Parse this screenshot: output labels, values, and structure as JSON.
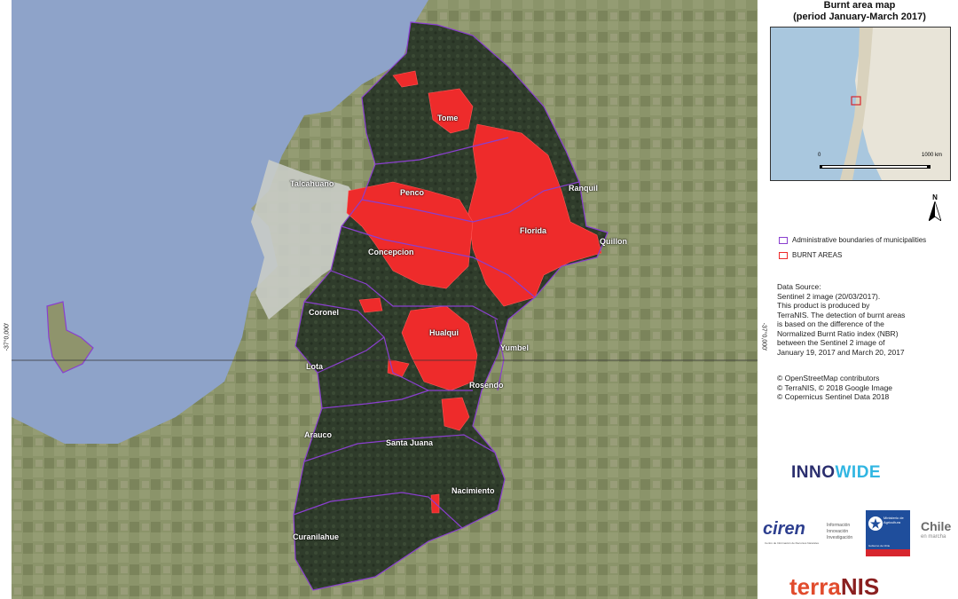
{
  "map": {
    "municipalities": [
      {
        "id": "tome",
        "name": "Tome"
      },
      {
        "id": "talcahuano",
        "name": "Talcahuano"
      },
      {
        "id": "penco",
        "name": "Penco"
      },
      {
        "id": "ranquil",
        "name": "Ranquil"
      },
      {
        "id": "florida",
        "name": "Florida"
      },
      {
        "id": "quillon",
        "name": "Quillon"
      },
      {
        "id": "concepcion",
        "name": "Concepcion"
      },
      {
        "id": "coronel",
        "name": "Coronel"
      },
      {
        "id": "hualqui",
        "name": "Hualqui"
      },
      {
        "id": "yumbel",
        "name": "Yumbel"
      },
      {
        "id": "lota",
        "name": "Lota"
      },
      {
        "id": "rosendo",
        "name": "Rosendo"
      },
      {
        "id": "arauco",
        "name": "Arauco"
      },
      {
        "id": "santa_juana",
        "name": "Santa Juana"
      },
      {
        "id": "nacimiento",
        "name": "Nacimiento"
      },
      {
        "id": "curanilahue",
        "name": "Curanilahue"
      }
    ],
    "coord_left": "-37°0,000'",
    "coord_right": "-37°0,000'"
  },
  "side": {
    "title_line1": "Burnt area map",
    "title_line2": "(period January-March 2017)",
    "inset": {
      "scale_start": "0",
      "scale_end": "1000 km"
    },
    "north_label": "N",
    "legend": [
      {
        "label": "Administrative boundaries of municipalities",
        "color": "#8a3fcf",
        "kind": "boundary"
      },
      {
        "label": "BURNT AREAS",
        "color": "#ee2b2b",
        "kind": "burnt"
      }
    ],
    "data_source": [
      "Data Source:",
      "Sentinel 2 image (20/03/2017).",
      "This product is produced by",
      "TerraNIS. The detection of burnt areas",
      "is based on the difference of the",
      "Normalized Burnt Ratio index (NBR)",
      "between the Sentinel 2 image of",
      "January 19, 2017 and March 20, 2017"
    ],
    "credits": [
      "© OpenStreetMap contributors",
      "© TerraNIS, © 2018 Google Image",
      "© Copernicus Sentinel Data 2018"
    ],
    "logos": {
      "innowide_a": "INNO",
      "innowide_b": "WIDE",
      "ciren": "ciren",
      "ciren_sub": "Centro de Información de Recursos Naturales",
      "ciren_lines": [
        "Información",
        "Innovación",
        "Investigación"
      ],
      "ministry": "Ministerio de Agricultura",
      "ministry_foot": "Gobierno de Chile",
      "chile": "Chile",
      "chile_sub": "en marcha",
      "terranis_a": "terra",
      "terranis_b": "NIS"
    }
  },
  "colors": {
    "sea": "#8aa0c7",
    "land": "#8a9368",
    "forest": "#2c3a29",
    "burnt": "#ee2b2b",
    "boundary": "#8a3fcf"
  }
}
